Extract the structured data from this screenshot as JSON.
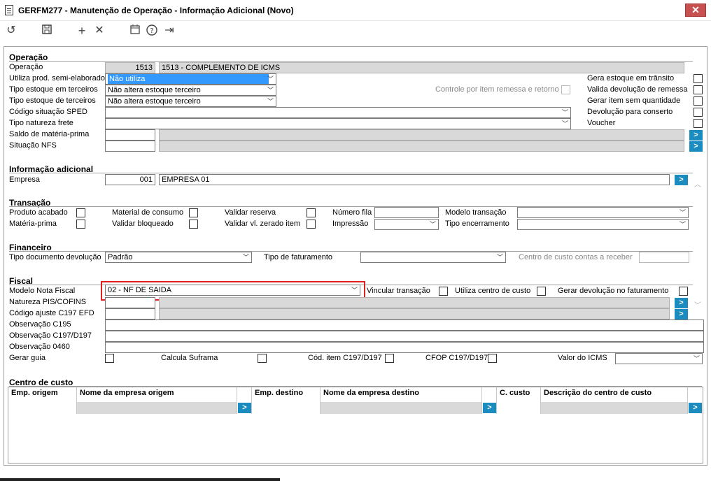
{
  "window": {
    "title": "GERFM277 - Manutenção de Operação - Informação Adicional (Novo)",
    "close": "✕"
  },
  "toolbar": {
    "undo": "↺",
    "save": "💾",
    "add": "+",
    "delete": "✕",
    "calendar": "📅",
    "help": "?",
    "exit": "⇥"
  },
  "operacao": {
    "section": "Operação",
    "operacao_label": "Operação",
    "operacao_code": "1513",
    "operacao_desc": "1513 - COMPLEMENTO DE ICMS",
    "semi_label": "Utiliza prod. semi-elaborado",
    "semi_value": "Não utiliza",
    "estoque_em_label": "Tipo estoque em terceiros",
    "estoque_em_value": "Não altera estoque terceiro",
    "estoque_de_label": "Tipo estoque de terceiros",
    "estoque_de_value": "Não altera estoque terceiro",
    "sped_label": "Código situação SPED",
    "frete_label": "Tipo natureza frete",
    "saldo_label": "Saldo de matéria-prima",
    "nfs_label": "Situação NFS",
    "controle_label": "Controle por item remessa e retorno",
    "gera_label": "Gera estoque em trânsito",
    "valida_label": "Valida devolução de remessa",
    "gerar_item_label": "Gerar item sem quantidade",
    "devolucao_label": "Devolução para conserto",
    "voucher_label": "Voucher"
  },
  "info": {
    "section": "Informação adicional",
    "empresa_label": "Empresa",
    "empresa_code": "001",
    "empresa_name": "EMPRESA 01"
  },
  "transacao": {
    "section": "Transação",
    "produto": "Produto acabado",
    "materia": "Matéria-prima",
    "consumo": "Material de consumo",
    "bloqueado": "Validar bloqueado",
    "reserva": "Validar reserva",
    "zerado": "Validar vl. zerado item",
    "fila": "Número fila",
    "impressao": "Impressão",
    "modelo": "Modelo transação",
    "encerramento": "Tipo encerramento"
  },
  "financeiro": {
    "section": "Financeiro",
    "devolucao_label": "Tipo documento devolução",
    "devolucao_value": "Padrão",
    "faturamento_label": "Tipo de faturamento",
    "centro_label": "Centro de custo contas a receber"
  },
  "fiscal": {
    "section": "Fiscal",
    "modelo_label": "Modelo Nota Fiscal",
    "modelo_value": "02 - NF DE SAIDA",
    "vincular": "Vincular transação",
    "utiliza_centro": "Utiliza centro de custo",
    "gerar_dev": "Gerar devolução no faturamento",
    "pis": "Natureza PIS/COFINS",
    "ajuste": "Código ajuste C197 EFD",
    "obs195": "Observação C195",
    "obs197": "Observação C197/D197",
    "obs460": "Observação 0460",
    "guia": "Gerar guia",
    "suframa": "Calcula Suframa",
    "cod_item": "Cód. item C197/D197",
    "cfop": "CFOP C197/D197",
    "valor_icms": "Valor do ICMS"
  },
  "centro": {
    "section": "Centro de custo",
    "columns": [
      "Emp. origem",
      "Nome da empresa origem",
      "Emp. destino",
      "Nome da empresa destino",
      "C. custo",
      "Descrição do centro de custo"
    ]
  },
  "colors": {
    "accent": "#1a8cc0",
    "highlight": "#e02020",
    "selection": "#3399ff"
  }
}
